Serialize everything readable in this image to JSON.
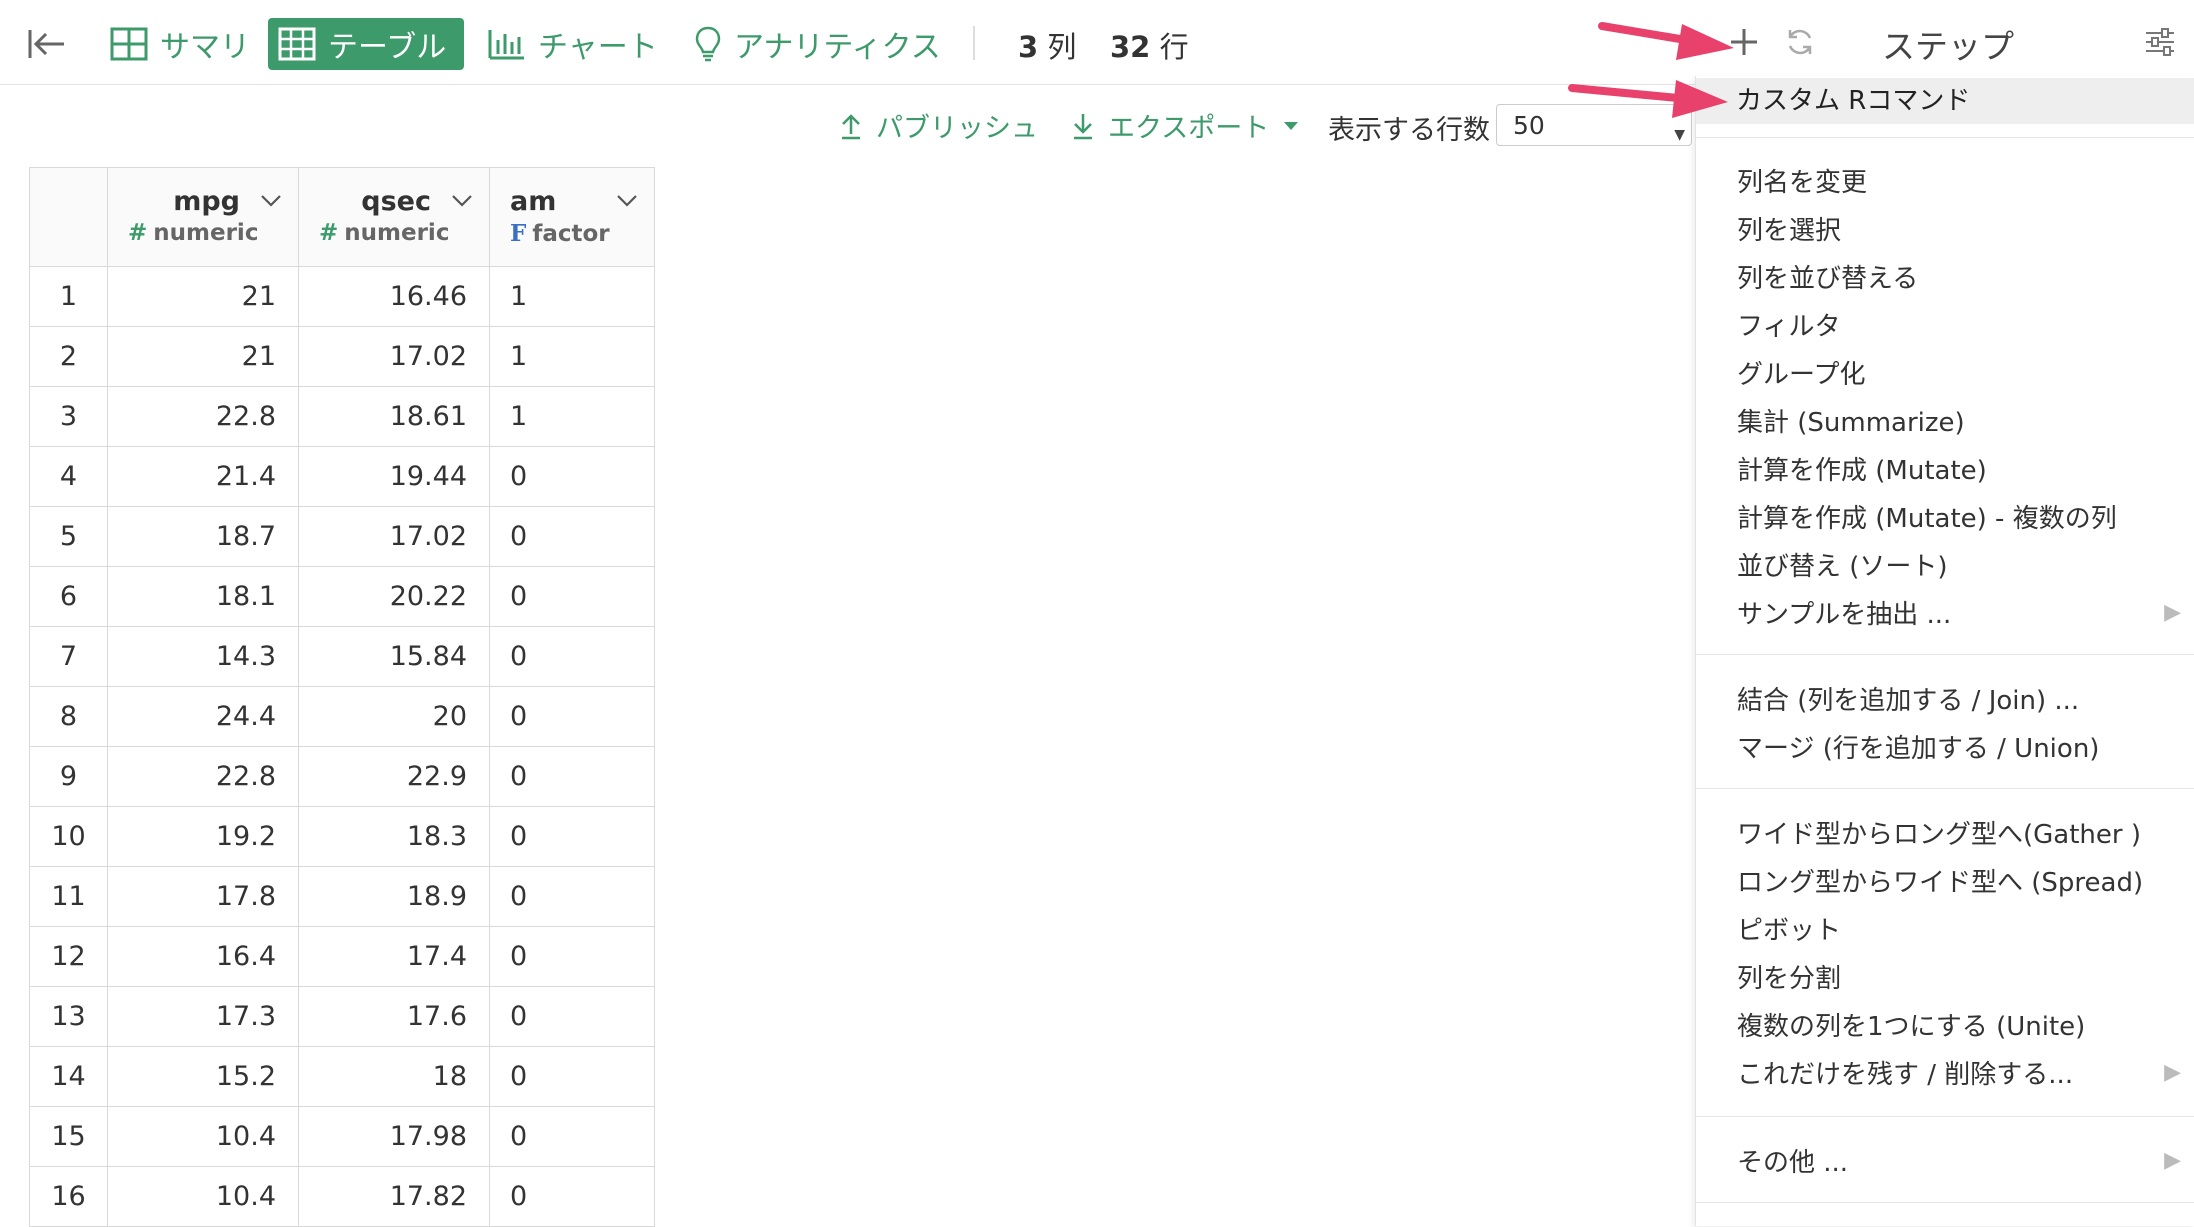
{
  "toolbar": {
    "tabs": [
      {
        "label": "サマリ"
      },
      {
        "label": "テーブル"
      },
      {
        "label": "チャート"
      },
      {
        "label": "アナリティクス"
      }
    ],
    "columns_count": "3",
    "columns_unit": "列",
    "rows_count": "32",
    "rows_unit": "行"
  },
  "subbar": {
    "publish": "パブリッシュ",
    "export": "エクスポート",
    "rows_label": "表示する行数",
    "rows_value": "50"
  },
  "table": {
    "columns": [
      {
        "name": "mpg",
        "type": "numeric",
        "type_mark": "#"
      },
      {
        "name": "qsec",
        "type": "numeric",
        "type_mark": "#"
      },
      {
        "name": "am",
        "type": "factor",
        "type_mark": "F"
      }
    ],
    "rows": [
      [
        "1",
        "21",
        "16.46",
        "1"
      ],
      [
        "2",
        "21",
        "17.02",
        "1"
      ],
      [
        "3",
        "22.8",
        "18.61",
        "1"
      ],
      [
        "4",
        "21.4",
        "19.44",
        "0"
      ],
      [
        "5",
        "18.7",
        "17.02",
        "0"
      ],
      [
        "6",
        "18.1",
        "20.22",
        "0"
      ],
      [
        "7",
        "14.3",
        "15.84",
        "0"
      ],
      [
        "8",
        "24.4",
        "20",
        "0"
      ],
      [
        "9",
        "22.8",
        "22.9",
        "0"
      ],
      [
        "10",
        "19.2",
        "18.3",
        "0"
      ],
      [
        "11",
        "17.8",
        "18.9",
        "0"
      ],
      [
        "12",
        "16.4",
        "17.4",
        "0"
      ],
      [
        "13",
        "17.3",
        "17.6",
        "0"
      ],
      [
        "14",
        "15.2",
        "18",
        "0"
      ],
      [
        "15",
        "10.4",
        "17.98",
        "0"
      ],
      [
        "16",
        "10.4",
        "17.82",
        "0"
      ]
    ]
  },
  "steps": {
    "title": "ステップ"
  },
  "menu": {
    "custom": "カスタム Rコマンド",
    "group1": [
      "列名を変更",
      "列を選択",
      "列を並び替える",
      "フィルタ",
      "グループ化",
      "集計 (Summarize)",
      "計算を作成 (Mutate)",
      "計算を作成 (Mutate) - 複数の列",
      "並び替え (ソート)",
      "サンプルを抽出 ..."
    ],
    "group2": [
      "結合 (列を追加する / Join) ...",
      "マージ (行を追加する / Union)"
    ],
    "group3": [
      "ワイド型からロング型へ(Gather )",
      "ロング型からワイド型へ (Spread)",
      "ピボット",
      "列を分割",
      "複数の列を1つにする (Unite)",
      "これだけを残す / 削除する..."
    ],
    "other": "その他 ..."
  },
  "colors": {
    "accent": "#3d9a6b",
    "annotation_arrow": "#e8416b",
    "factor_mark": "#3a6fc4"
  }
}
